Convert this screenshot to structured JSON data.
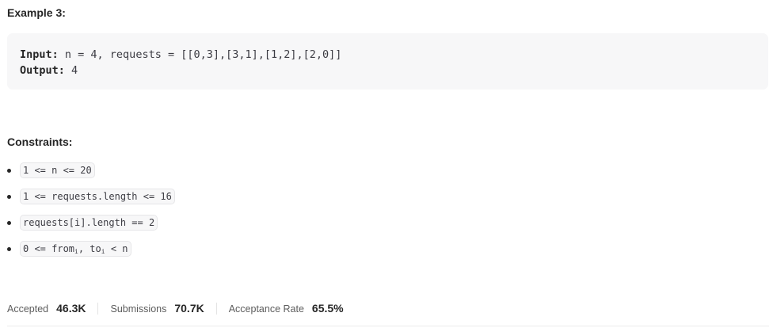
{
  "example": {
    "title": "Example 3:",
    "input_label": "Input:",
    "input_value": " n = 4, requests = [[0,3],[3,1],[1,2],[2,0]]",
    "output_label": "Output:",
    "output_value": " 4"
  },
  "constraints": {
    "title": "Constraints:",
    "items": [
      "1 <= n <= 20",
      "1 <= requests.length <= 16",
      "requests[i].length == 2"
    ],
    "item4": {
      "part1": "0 <= from",
      "sub1": "i",
      "part2": ", to",
      "sub2": "i",
      "part3": " < n"
    }
  },
  "stats": {
    "accepted_label": "Accepted",
    "accepted_value": "46.3K",
    "submissions_label": "Submissions",
    "submissions_value": "70.7K",
    "acceptance_rate_label": "Acceptance Rate",
    "acceptance_rate_value": "65.5%"
  }
}
